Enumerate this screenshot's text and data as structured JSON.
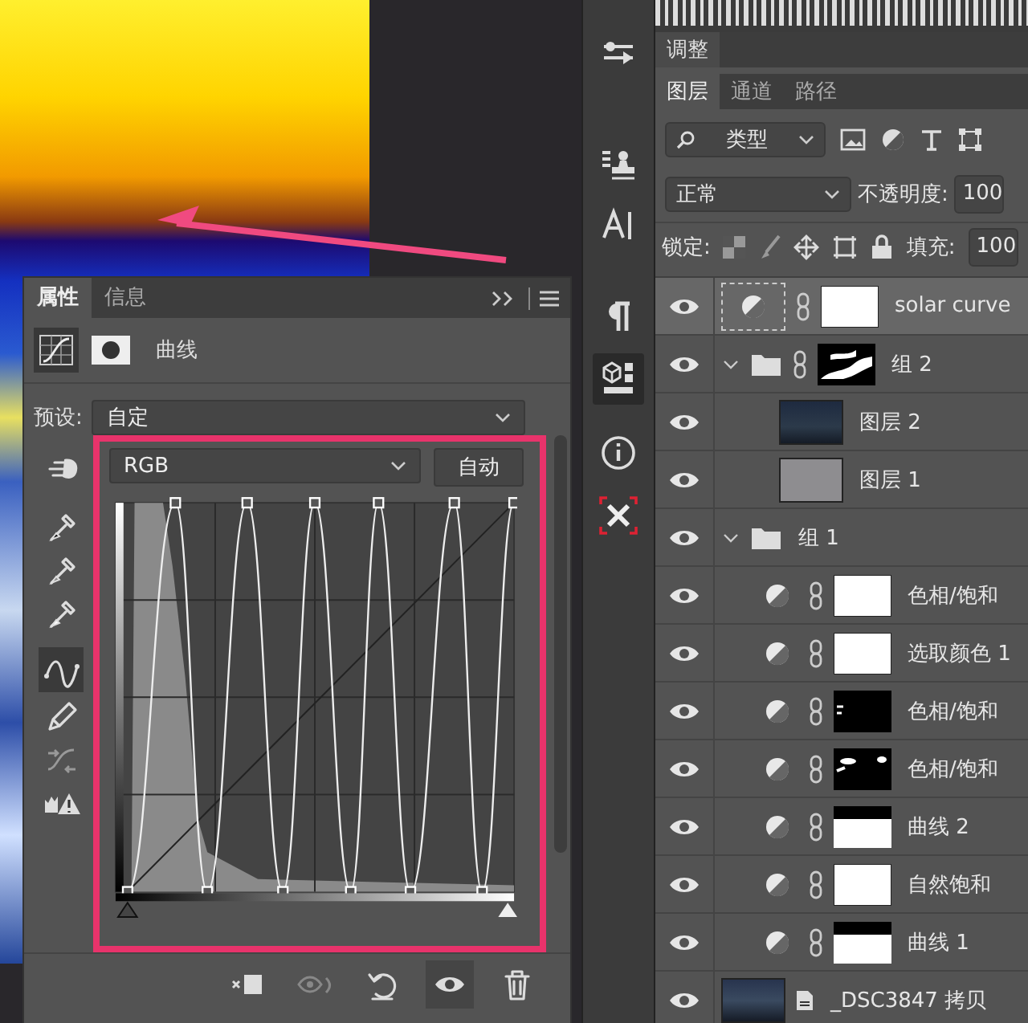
{
  "properties": {
    "tabs": [
      {
        "label": "属性",
        "selected": true
      },
      {
        "label": "信息",
        "selected": false
      }
    ],
    "title": "曲线",
    "input_sliders": [
      {
        "level": 0.03
      },
      {
        "level": 1.0
      }
    ],
    "preset_label": "预设:",
    "preset": "自定",
    "channel": "RGB",
    "auto_button": "自动",
    "tools": [
      {
        "kind": "target",
        "selected": false
      },
      {
        "kind": "black-point",
        "selected": false
      },
      {
        "kind": "gray-point",
        "selected": false
      },
      {
        "kind": "white-point",
        "selected": false
      },
      {
        "kind": "curve",
        "selected": true
      },
      {
        "kind": "pencil",
        "selected": false
      },
      {
        "kind": "smooth",
        "selected": false
      },
      {
        "kind": "clip-warning",
        "selected": false
      }
    ],
    "footer_tools": [
      {
        "kind": "clip",
        "selected": false
      },
      {
        "kind": "view-previous",
        "selected": false
      },
      {
        "kind": "reset",
        "selected": false
      },
      {
        "kind": "visibility",
        "selected": true
      },
      {
        "kind": "delete",
        "selected": false
      }
    ]
  },
  "strip": [
    {
      "kind": "sliders",
      "selected": false
    },
    {
      "kind": "stamp",
      "selected": false
    },
    {
      "kind": "character",
      "selected": false
    },
    {
      "kind": "paragraph",
      "selected": false
    },
    {
      "kind": "cube",
      "selected": true
    },
    {
      "kind": "info",
      "selected": false
    },
    {
      "kind": "transform",
      "selected": false
    }
  ],
  "adjustments_tab": "调整",
  "layers": {
    "tabs": [
      {
        "label": "图层",
        "selected": true
      },
      {
        "label": "通道",
        "selected": false
      },
      {
        "label": "路径",
        "selected": false
      }
    ],
    "filter": "类型",
    "blend": "正常",
    "opacity_label": "不透明度:",
    "opacity": "100",
    "lock_label": "锁定:",
    "fill_label": "填充:",
    "fill": "100",
    "items": [
      {
        "name": "solar curve",
        "kind": "adjustment",
        "mask": {
          "kind": "white"
        },
        "visible": true,
        "selected": true
      },
      {
        "name": "组 2",
        "kind": "group",
        "mask": {
          "kind": "clouds"
        },
        "visible": true,
        "selected": false,
        "expanded": true,
        "children": [
          {
            "name": "图层 2",
            "kind": "photo",
            "visible": true,
            "selected": false
          },
          {
            "name": "图层 1",
            "kind": "fill",
            "visible": true,
            "selected": false
          }
        ]
      },
      {
        "name": "组 1",
        "kind": "group",
        "visible": true,
        "selected": false,
        "expanded": true,
        "children": [
          {
            "name": "色相/饱和",
            "kind": "adjustment",
            "mask": {
              "kind": "white"
            },
            "visible": true,
            "selected": false
          },
          {
            "name": "选取颜色 1",
            "kind": "adjustment",
            "mask": {
              "kind": "white"
            },
            "visible": true,
            "selected": false
          },
          {
            "name": "色相/饱和",
            "kind": "adjustment",
            "mask": {
              "kind": "black"
            },
            "visible": true,
            "selected": false
          },
          {
            "name": "色相/饱和",
            "kind": "adjustment",
            "mask": {
              "kind": "spots"
            },
            "visible": true,
            "selected": false
          },
          {
            "name": "曲线 2",
            "kind": "adjustment",
            "mask": {
              "kind": "top-black"
            },
            "visible": true,
            "selected": false
          },
          {
            "name": "自然饱和",
            "kind": "adjustment",
            "mask": {
              "kind": "white"
            },
            "visible": true,
            "selected": false
          },
          {
            "name": "曲线 1",
            "kind": "adjustment",
            "mask": {
              "kind": "top-black"
            },
            "visible": true,
            "selected": false
          }
        ]
      },
      {
        "name": "_DSC3847 拷贝",
        "kind": "smart",
        "visible": true,
        "selected": false
      }
    ]
  }
}
